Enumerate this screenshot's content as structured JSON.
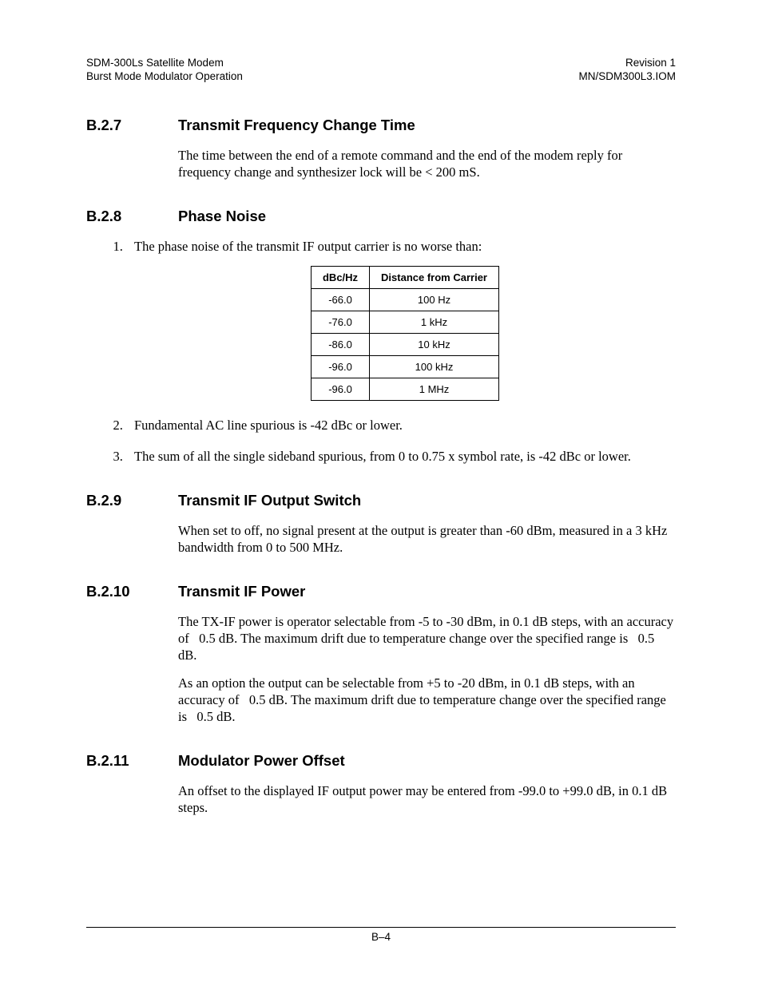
{
  "header": {
    "left1": "SDM-300Ls Satellite Modem",
    "right1": "Revision 1",
    "left2": "Burst Mode Modulator Operation",
    "right2": "MN/SDM300L3.IOM"
  },
  "sections": {
    "s1": {
      "num": "B.2.7",
      "title": "Transmit Frequency Change Time",
      "p1": "The time between the end of a remote command and the end of the modem reply for frequency change and synthesizer lock will be < 200 mS."
    },
    "s2": {
      "num": "B.2.8",
      "title": "Phase Noise",
      "li1": "The phase noise of the transmit IF output carrier is no worse than:",
      "li2": "Fundamental AC line spurious is -42 dBc or lower.",
      "li3": "The sum of all the single sideband spurious, from 0 to 0.75 x symbol rate, is -42 dBc or lower.",
      "th1": "dBc/Hz",
      "th2": "Distance from Carrier",
      "rows": {
        "r0c0": "-66.0",
        "r0c1": "100 Hz",
        "r1c0": "-76.0",
        "r1c1": "1 kHz",
        "r2c0": "-86.0",
        "r2c1": "10 kHz",
        "r3c0": "-96.0",
        "r3c1": "100 kHz",
        "r4c0": "-96.0",
        "r4c1": "1 MHz"
      }
    },
    "s3": {
      "num": "B.2.9",
      "title": "Transmit IF Output Switch",
      "p1": "When set to off, no signal present at the output is greater than -60 dBm, measured in a 3 kHz bandwidth from 0 to 500 MHz."
    },
    "s4": {
      "num": "B.2.10",
      "title": "Transmit IF Power",
      "p1": "The TX-IF power is operator selectable from -5 to -30 dBm, in 0.1 dB steps, with an accuracy of   0.5 dB. The maximum drift due to temperature change over the specified range is   0.5 dB.",
      "p2": "As an option the output can be selectable from +5 to -20 dBm, in 0.1 dB steps, with an accuracy of   0.5 dB. The maximum drift due to temperature change over the specified range is   0.5 dB."
    },
    "s5": {
      "num": "B.2.11",
      "title": "Modulator Power Offset",
      "p1": "An offset to the displayed IF output power may be entered from -99.0 to +99.0 dB, in 0.1 dB steps."
    }
  },
  "footer": {
    "page": "B–4"
  },
  "chart_data": {
    "type": "table",
    "title": "Phase Noise vs Distance from Carrier",
    "columns": [
      "dBc/Hz",
      "Distance from Carrier"
    ],
    "rows": [
      [
        -66.0,
        "100 Hz"
      ],
      [
        -76.0,
        "1 kHz"
      ],
      [
        -86.0,
        "10 kHz"
      ],
      [
        -96.0,
        "100 kHz"
      ],
      [
        -96.0,
        "1 MHz"
      ]
    ]
  }
}
